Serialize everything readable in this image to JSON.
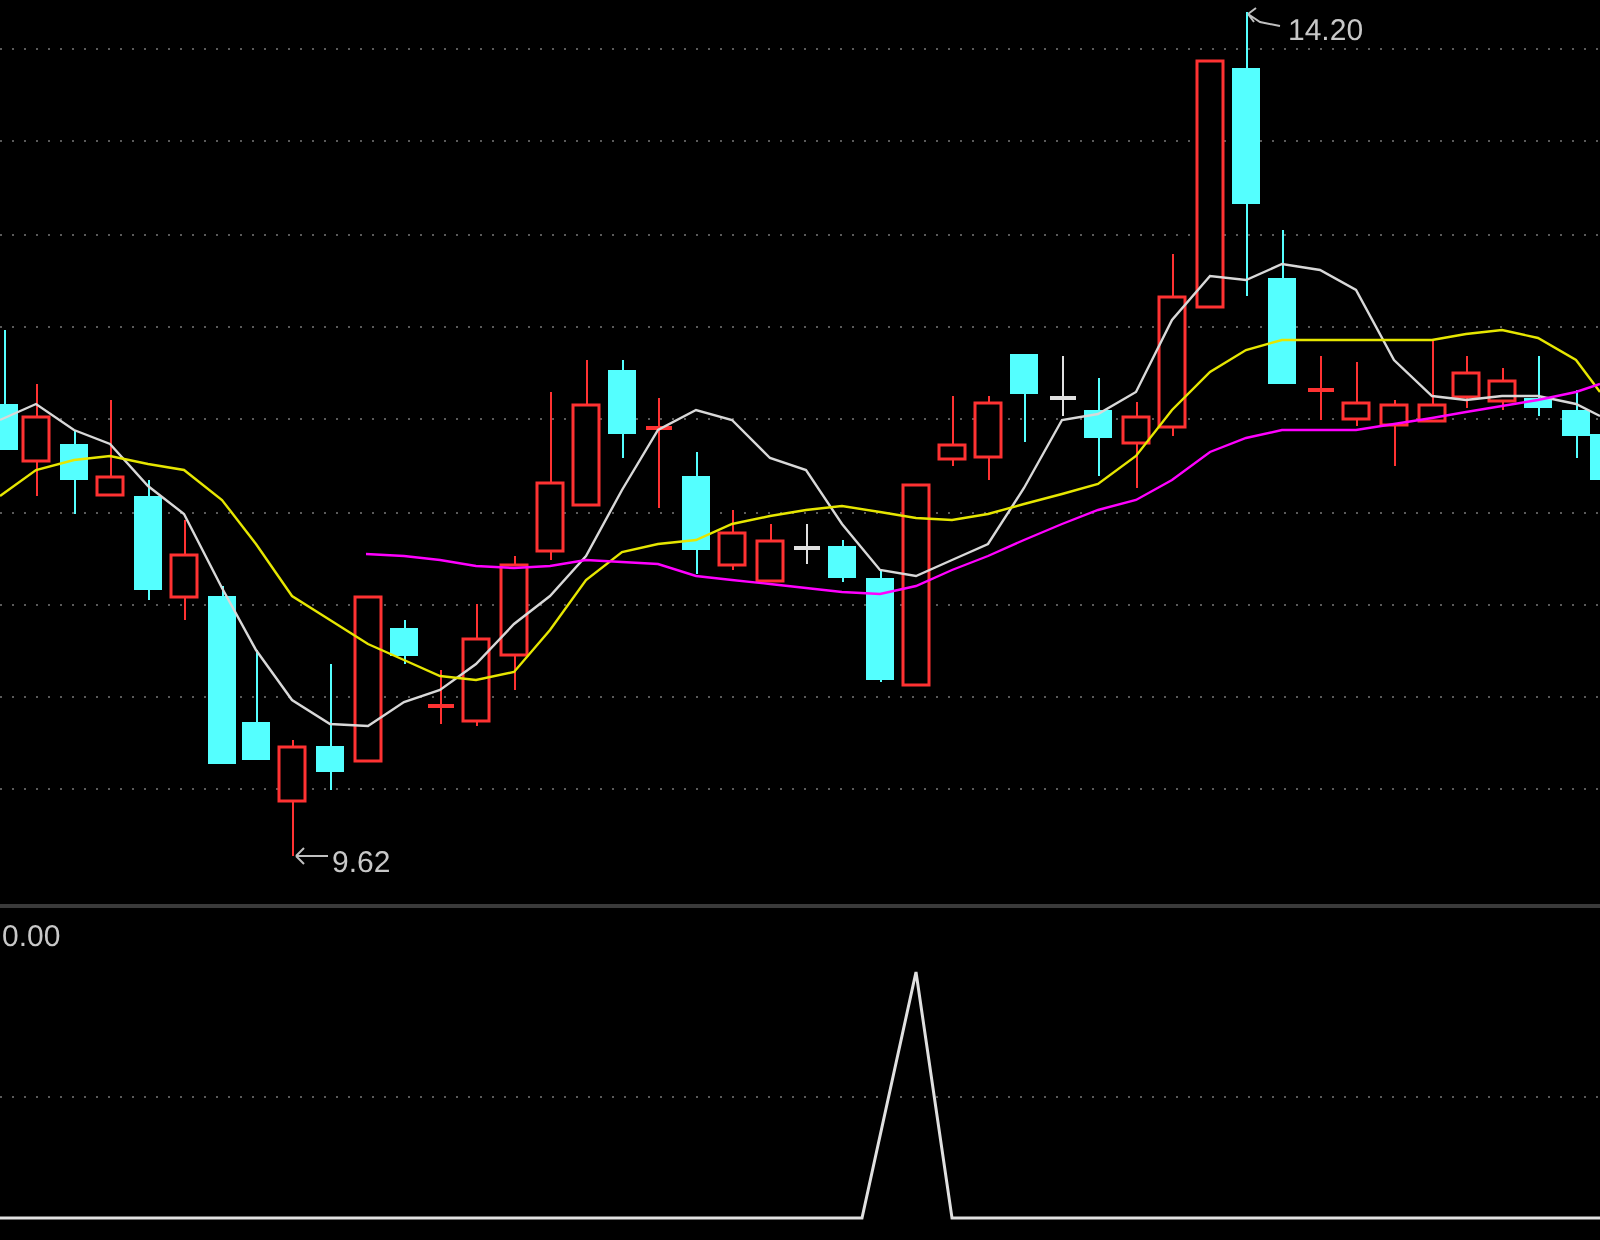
{
  "main_chart": {
    "high_label": "14.20",
    "low_label": "9.62"
  },
  "indicator_panel": {
    "value_label": "0.00"
  }
}
